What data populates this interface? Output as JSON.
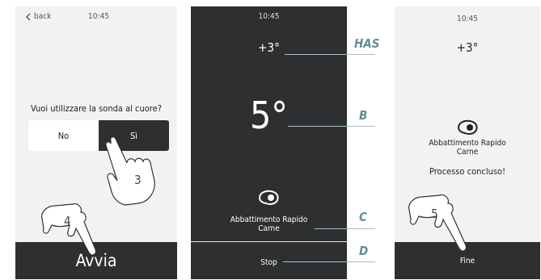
{
  "screen1": {
    "back_label": "back",
    "time": "10:45",
    "question": "Vuoi utilizzare la sonda al cuore?",
    "option_no": "No",
    "option_yes": "Sì",
    "start_label": "Avvia",
    "steps": [
      "3",
      "4"
    ]
  },
  "screen2": {
    "time": "10:45",
    "target_temp": "+3°",
    "current_temp": "5°",
    "program_line1": "Abbattimento Rapido",
    "program_line2": "Carne",
    "stop_label": "Stop"
  },
  "screen3": {
    "time": "10:45",
    "target_temp": "+3°",
    "program_line1": "Abbattimento Rapido",
    "program_line2": "Carne",
    "status": "Processo concluso!",
    "finish_label": "Fine",
    "step": "5"
  },
  "callouts": {
    "has": "HAS",
    "b": "B",
    "c": "C",
    "d": "D"
  },
  "colors": {
    "dark": "#2d2f31",
    "light": "#f2f2f2",
    "callout": "#5e8e96"
  },
  "icons": [
    "chevron-left-icon",
    "meat-icon",
    "hand-pointer-icon"
  ]
}
